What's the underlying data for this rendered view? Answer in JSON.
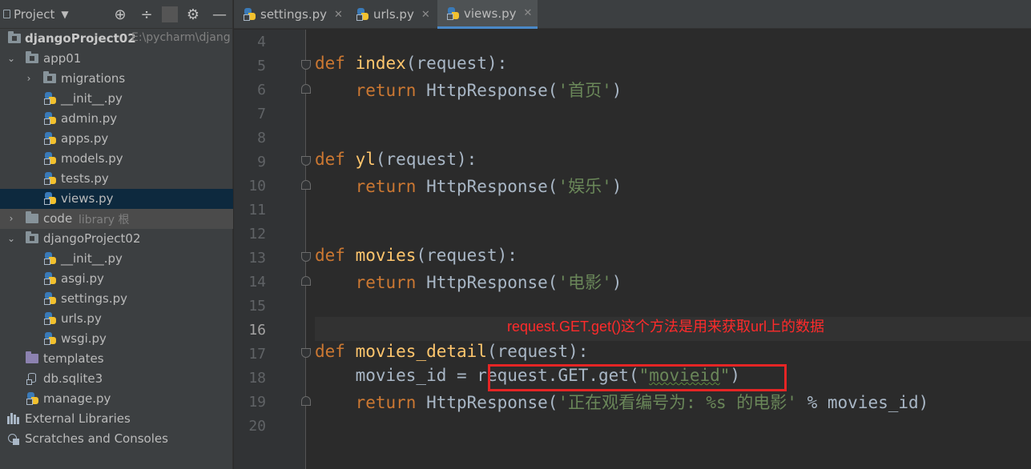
{
  "project_panel": {
    "title": "Project",
    "header_icons": [
      "target-icon",
      "collapse-icon",
      "gear-icon",
      "minimize-icon"
    ]
  },
  "tree": {
    "root": {
      "label": "djangoProject02",
      "path": "E:\\pycharm\\djang"
    },
    "app01": "app01",
    "migrations": "migrations",
    "app01_init": "__init__.py",
    "admin": "admin.py",
    "apps": "apps.py",
    "models": "models.py",
    "tests": "tests.py",
    "views": "views.py",
    "code": {
      "label": "code",
      "suffix": "library 根"
    },
    "pkg": "djangoProject02",
    "pkg_init": "__init__.py",
    "asgi": "asgi.py",
    "settings": "settings.py",
    "urls": "urls.py",
    "wsgi": "wsgi.py",
    "templates": "templates",
    "db": "db.sqlite3",
    "manage": "manage.py",
    "external": "External Libraries",
    "scratches": "Scratches and Consoles"
  },
  "tabs": [
    {
      "label": "settings.py",
      "active": false
    },
    {
      "label": "urls.py",
      "active": false
    },
    {
      "label": "views.py",
      "active": true
    }
  ],
  "editor": {
    "current_line": 16,
    "line_numbers": [
      "4",
      "5",
      "6",
      "7",
      "8",
      "9",
      "10",
      "11",
      "12",
      "13",
      "14",
      "15",
      "16",
      "17",
      "18",
      "19",
      "20"
    ],
    "code": {
      "l5_kw": "def",
      "l5_fn": "index",
      "l5_rest": "(request):",
      "l6_kw": "return",
      "l6_a": " HttpResponse(",
      "l6_str": "'首页'",
      "l6_b": ")",
      "l9_kw": "def",
      "l9_fn": "yl",
      "l9_rest": "(request):",
      "l10_kw": "return",
      "l10_a": " HttpResponse(",
      "l10_str": "'娱乐'",
      "l10_b": ")",
      "l13_kw": "def",
      "l13_fn": "movies",
      "l13_rest": "(request):",
      "l14_kw": "return",
      "l14_a": " HttpResponse(",
      "l14_str": "'电影'",
      "l14_b": ")",
      "l17_kw": "def",
      "l17_fn": "movies_detail",
      "l17_rest": "(request):",
      "l18_a": "movies_id = request.GET.get(",
      "l18_q1": "\"",
      "l18_str": "movieid",
      "l18_q2": "\"",
      "l18_b": ")",
      "l19_kw": "return",
      "l19_a": " HttpResponse(",
      "l19_str": "'正在观看编号为: %s 的电影'",
      "l19_b": " % movies_id)"
    },
    "annotation": "request.GET.get()这个方法是用来获取url上的数据",
    "annotation_color": "#ff2b2b"
  },
  "colors": {
    "keyword": "#cc7832",
    "function": "#ffc66d",
    "string": "#6a8759",
    "selection": "#0d293e",
    "active_tab_underline": "#4a88c7"
  }
}
